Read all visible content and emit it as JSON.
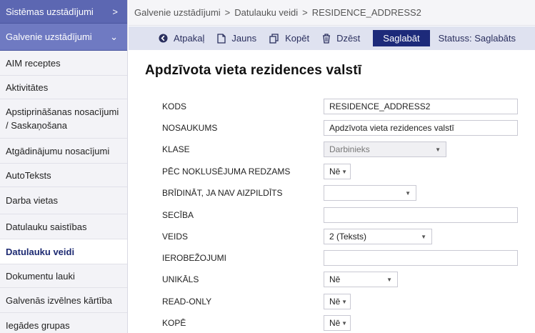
{
  "sidebar": {
    "groups": [
      {
        "label": "Sistēmas uzstādījumi",
        "chevron": ">"
      },
      {
        "label": "Galvenie uzstādījumi",
        "chevron": "⌄"
      }
    ],
    "items": [
      {
        "label": "AIM receptes"
      },
      {
        "label": "Aktivitātes"
      },
      {
        "label": "Apstiprināšanas nosacījumi / Saskaņošana"
      },
      {
        "label": "Atgādinājumu nosacījumi"
      },
      {
        "label": "AutoTeksts"
      },
      {
        "label": "Darba vietas"
      },
      {
        "label": "Datulauku saistības"
      },
      {
        "label": "Datulauku veidi"
      },
      {
        "label": "Dokumentu lauki"
      },
      {
        "label": "Galvenās izvēlnes kārtība"
      },
      {
        "label": "Iegādes grupas"
      }
    ]
  },
  "breadcrumb": {
    "items": [
      "Galvenie uzstādījumi",
      "Datulauku veidi",
      "RESIDENCE_ADDRESS2"
    ],
    "separator": ">"
  },
  "toolbar": {
    "back": "Atpakaļ",
    "new": "Jauns",
    "copy": "Kopēt",
    "delete": "Dzēst",
    "save": "Saglabāt",
    "status": "Statuss: Saglabāts"
  },
  "page_title": "Apdzīvota vieta rezidences valstī",
  "form": {
    "kods": {
      "label": "KODS",
      "value": "RESIDENCE_ADDRESS2"
    },
    "nosaukums": {
      "label": "NOSAUKUMS",
      "value": "Apdzīvota vieta rezidences valstī"
    },
    "klase": {
      "label": "KLASE",
      "value": "Darbinieks"
    },
    "redzams": {
      "label": "PĒC NOKLUSĒJUMA REDZAMS",
      "value": "Nē"
    },
    "bridinat": {
      "label": "BRĪDINĀT, JA NAV AIZPILDĪTS",
      "value": ""
    },
    "seciba": {
      "label": "SECĪBA",
      "value": ""
    },
    "veids": {
      "label": "VEIDS",
      "value": "2 (Teksts)"
    },
    "ierobezojumi": {
      "label": "IEROBEŽOJUMI",
      "value": ""
    },
    "unikals": {
      "label": "UNIKĀLS",
      "value": "Nē"
    },
    "readonly": {
      "label": "READ-ONLY",
      "value": "Nē"
    },
    "kope": {
      "label": "KOPĒ",
      "value": "Nē"
    }
  },
  "colors": {
    "sidebar_group": "#5c67b2",
    "toolbar_bg": "#dfe2f0",
    "save_button": "#1d2a7a",
    "active_item_text": "#1d2a72"
  },
  "icons": {
    "back": "arrow-left-circle-icon",
    "new": "new-document-icon",
    "copy": "copy-icon",
    "delete": "trash-icon",
    "dropdown": "chevron-down-icon"
  }
}
